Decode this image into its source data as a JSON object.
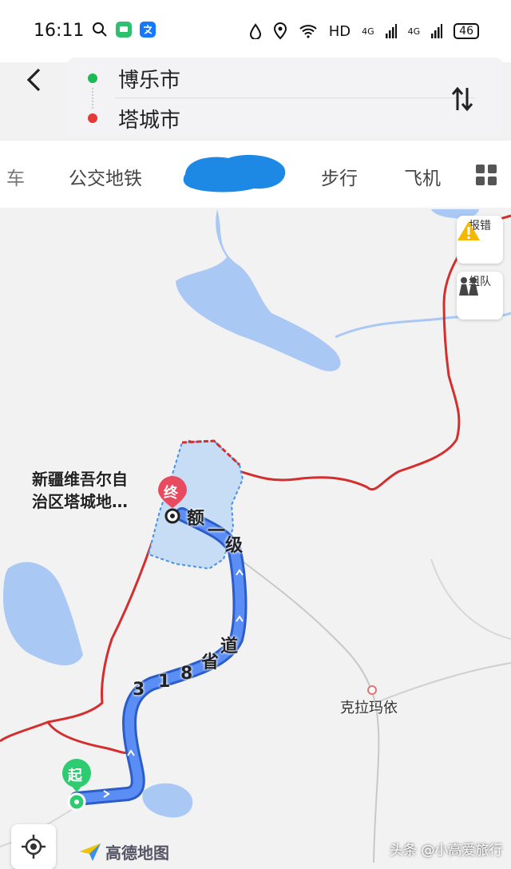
{
  "status_bar": {
    "time": "16:11",
    "network_label": "HD",
    "signal_1": "4G",
    "signal_2": "4G",
    "battery": "46"
  },
  "route": {
    "origin": "博乐市",
    "destination": "塔城市",
    "origin_color": "#1db954",
    "destination_color": "#e53935"
  },
  "tabs": [
    {
      "label": "车"
    },
    {
      "label": "公交地铁"
    },
    {
      "label": "步行"
    },
    {
      "label": "飞机"
    }
  ],
  "map": {
    "side_buttons": {
      "report": "报错",
      "team": "组队"
    },
    "destination_area_label_line1": "新疆维吾尔自",
    "destination_area_label_line2": "治区塔城地…",
    "end_marker": "终",
    "start_marker": "起",
    "road_label_1": "额",
    "road_label_2": "一",
    "road_label_3": "级",
    "road_label_4": "3",
    "road_label_5": "1",
    "road_label_6": "8",
    "road_label_7": "省",
    "road_label_8": "道",
    "town": "克拉玛依",
    "logo": "高德地图",
    "route_color": "#4a7ef0",
    "border_color": "#d32f2f",
    "water_color": "#a9c8f4"
  },
  "watermark": "头条 @小高爱旅行"
}
